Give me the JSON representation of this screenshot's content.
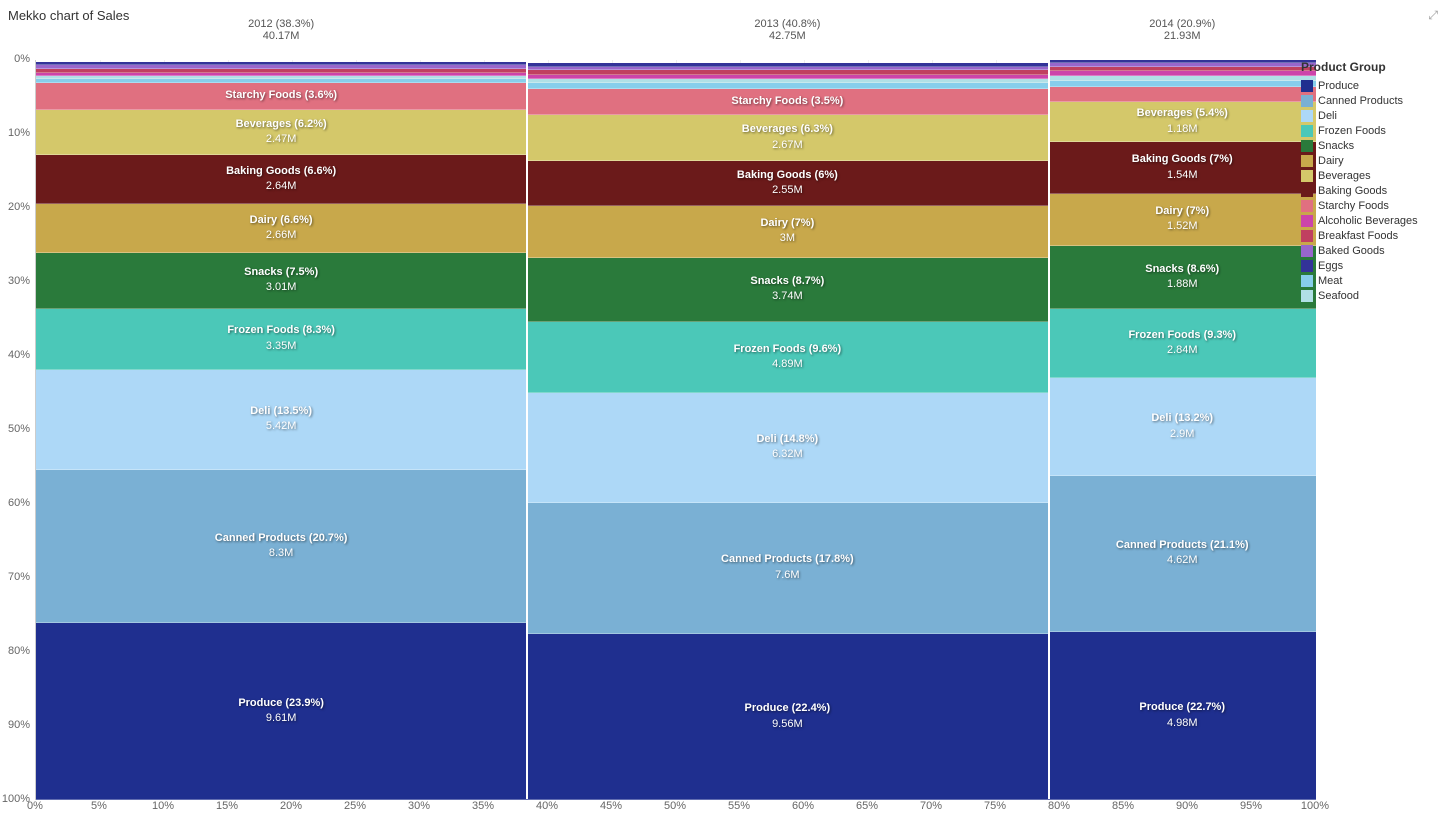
{
  "title": "Mekko chart of Sales",
  "chart": {
    "years": [
      {
        "label": "2012 (38.3%)",
        "sublabel": "40.17M",
        "xStart": 0,
        "width": 38.3
      },
      {
        "label": "2013 (40.8%)",
        "sublabel": "42.75M",
        "xStart": 38.3,
        "width": 40.8
      },
      {
        "label": "2014 (20.9%)",
        "sublabel": "21.93M",
        "xStart": 79.1,
        "width": 20.9
      }
    ],
    "yLabels": [
      "0%",
      "10%",
      "20%",
      "30%",
      "40%",
      "50%",
      "60%",
      "70%",
      "80%",
      "90%",
      "100%"
    ],
    "xLabels": [
      "0%",
      "5%",
      "10%",
      "15%",
      "20%",
      "25%",
      "30%",
      "35%",
      "40%",
      "45%",
      "50%",
      "55%",
      "60%",
      "65%",
      "70%",
      "75%",
      "80%",
      "85%",
      "90%",
      "95%",
      "100%"
    ],
    "segments": {
      "2012": [
        {
          "name": "Produce",
          "pct": 23.9,
          "value": "9.61M",
          "color": "#1f2f8f",
          "yStart": 0,
          "height": 23.9
        },
        {
          "name": "Canned Products",
          "pct": 20.7,
          "value": "8.3M",
          "color": "#7ab0d4",
          "yStart": 23.9,
          "height": 20.7
        },
        {
          "name": "Deli",
          "pct": 13.5,
          "value": "5.42M",
          "color": "#add8f7",
          "yStart": 44.6,
          "height": 13.5
        },
        {
          "name": "Frozen Foods",
          "pct": 8.3,
          "value": "3.35M",
          "color": "#4bc8b8",
          "yStart": 58.1,
          "height": 8.3
        },
        {
          "name": "Snacks",
          "pct": 7.5,
          "value": "3.01M",
          "color": "#2a7a3b",
          "yStart": 66.4,
          "height": 7.5
        },
        {
          "name": "Dairy",
          "pct": 6.6,
          "value": "2.66M",
          "color": "#c8a84b",
          "yStart": 73.9,
          "height": 6.6
        },
        {
          "name": "Baking Goods",
          "pct": 6.6,
          "value": "2.64M",
          "color": "#6b1a1a",
          "yStart": 80.5,
          "height": 6.6
        },
        {
          "name": "Beverages",
          "pct": 6.2,
          "value": "2.47M",
          "color": "#d4c86a",
          "yStart": 87.1,
          "height": 6.2
        },
        {
          "name": "Starchy Foods",
          "pct": 3.6,
          "value": "",
          "color": "#e07080",
          "yStart": 93.3,
          "height": 3.6
        },
        {
          "name": "Meat",
          "pct": 0.5,
          "value": "",
          "color": "#87CEEB",
          "yStart": 96.9,
          "height": 0.5
        },
        {
          "name": "Seafood",
          "pct": 0.4,
          "value": "",
          "color": "#b0e0e6",
          "yStart": 97.4,
          "height": 0.4
        },
        {
          "name": "Alcoholic Beverages",
          "pct": 0.5,
          "value": "",
          "color": "#cc44aa",
          "yStart": 97.8,
          "height": 0.5
        },
        {
          "name": "Breakfast Foods",
          "pct": 0.5,
          "value": "",
          "color": "#c04060",
          "yStart": 98.3,
          "height": 0.5
        },
        {
          "name": "Baked Goods",
          "pct": 0.5,
          "value": "",
          "color": "#9966cc",
          "yStart": 98.8,
          "height": 0.5
        },
        {
          "name": "Eggs",
          "pct": 0.4,
          "value": "",
          "color": "#333399",
          "yStart": 99.3,
          "height": 0.4
        }
      ],
      "2013": [
        {
          "name": "Produce",
          "pct": 22.4,
          "value": "9.56M",
          "color": "#1f2f8f",
          "yStart": 0,
          "height": 22.4
        },
        {
          "name": "Canned Products",
          "pct": 17.8,
          "value": "7.6M",
          "color": "#7ab0d4",
          "yStart": 22.4,
          "height": 17.8
        },
        {
          "name": "Deli",
          "pct": 14.8,
          "value": "6.32M",
          "color": "#add8f7",
          "yStart": 40.2,
          "height": 14.8
        },
        {
          "name": "Frozen Foods",
          "pct": 9.6,
          "value": "4.89M",
          "color": "#4bc8b8",
          "yStart": 55.0,
          "height": 9.6
        },
        {
          "name": "Snacks",
          "pct": 8.7,
          "value": "3.74M",
          "color": "#2a7a3b",
          "yStart": 64.6,
          "height": 8.7
        },
        {
          "name": "Dairy",
          "pct": 7.0,
          "value": "3M",
          "color": "#c8a84b",
          "yStart": 73.3,
          "height": 7.0
        },
        {
          "name": "Baking Goods",
          "pct": 6.0,
          "value": "2.55M",
          "color": "#6b1a1a",
          "yStart": 80.3,
          "height": 6.0
        },
        {
          "name": "Beverages",
          "pct": 6.3,
          "value": "2.67M",
          "color": "#d4c86a",
          "yStart": 86.3,
          "height": 6.3
        },
        {
          "name": "Starchy Foods",
          "pct": 3.5,
          "value": "",
          "color": "#e07080",
          "yStart": 92.6,
          "height": 3.5
        },
        {
          "name": "Meat",
          "pct": 0.8,
          "value": "",
          "color": "#87CEEB",
          "yStart": 96.1,
          "height": 0.8
        },
        {
          "name": "Seafood",
          "pct": 0.5,
          "value": "",
          "color": "#b0e0e6",
          "yStart": 96.9,
          "height": 0.5
        },
        {
          "name": "Alcoholic Beverages",
          "pct": 0.6,
          "value": "",
          "color": "#cc44aa",
          "yStart": 97.4,
          "height": 0.6
        },
        {
          "name": "Breakfast Foods",
          "pct": 0.6,
          "value": "",
          "color": "#c04060",
          "yStart": 98.0,
          "height": 0.6
        },
        {
          "name": "Baked Goods",
          "pct": 0.6,
          "value": "",
          "color": "#9966cc",
          "yStart": 98.6,
          "height": 0.6
        },
        {
          "name": "Eggs",
          "pct": 0.5,
          "value": "",
          "color": "#333399",
          "yStart": 99.1,
          "height": 0.5
        }
      ],
      "2014": [
        {
          "name": "Produce",
          "pct": 22.7,
          "value": "4.98M",
          "color": "#1f2f8f",
          "yStart": 0,
          "height": 22.7
        },
        {
          "name": "Canned Products",
          "pct": 21.1,
          "value": "4.62M",
          "color": "#7ab0d4",
          "yStart": 22.7,
          "height": 21.1
        },
        {
          "name": "Deli",
          "pct": 13.2,
          "value": "2.9M",
          "color": "#add8f7",
          "yStart": 43.8,
          "height": 13.2
        },
        {
          "name": "Frozen Foods",
          "pct": 9.3,
          "value": "2.84M",
          "color": "#4bc8b8",
          "yStart": 57.0,
          "height": 9.3
        },
        {
          "name": "Snacks",
          "pct": 8.6,
          "value": "1.88M",
          "color": "#2a7a3b",
          "yStart": 66.3,
          "height": 8.6
        },
        {
          "name": "Dairy",
          "pct": 7.0,
          "value": "1.52M",
          "color": "#c8a84b",
          "yStart": 74.9,
          "height": 7.0
        },
        {
          "name": "Baking Goods",
          "pct": 7.0,
          "value": "1.54M",
          "color": "#6b1a1a",
          "yStart": 81.9,
          "height": 7.0
        },
        {
          "name": "Beverages",
          "pct": 5.4,
          "value": "1.18M",
          "color": "#d4c86a",
          "yStart": 88.9,
          "height": 5.4
        },
        {
          "name": "Starchy Foods",
          "pct": 2.0,
          "value": "",
          "color": "#e07080",
          "yStart": 94.3,
          "height": 2.0
        },
        {
          "name": "Meat",
          "pct": 0.8,
          "value": "",
          "color": "#87CEEB",
          "yStart": 96.3,
          "height": 0.8
        },
        {
          "name": "Seafood",
          "pct": 0.7,
          "value": "",
          "color": "#b0e0e6",
          "yStart": 97.1,
          "height": 0.7
        },
        {
          "name": "Alcoholic Beverages",
          "pct": 0.7,
          "value": "",
          "color": "#cc44aa",
          "yStart": 97.8,
          "height": 0.7
        },
        {
          "name": "Breakfast Foods",
          "pct": 0.6,
          "value": "",
          "color": "#c04060",
          "yStart": 98.5,
          "height": 0.6
        },
        {
          "name": "Baked Goods",
          "pct": 0.5,
          "value": "",
          "color": "#9966cc",
          "yStart": 99.1,
          "height": 0.5
        },
        {
          "name": "Eggs",
          "pct": 0.4,
          "value": "",
          "color": "#333399",
          "yStart": 99.6,
          "height": 0.4
        }
      ]
    }
  },
  "legend": {
    "title": "Product Group",
    "items": [
      {
        "name": "Produce",
        "color": "#1f2f8f"
      },
      {
        "name": "Canned Products",
        "color": "#7ab0d4"
      },
      {
        "name": "Deli",
        "color": "#add8f7"
      },
      {
        "name": "Frozen Foods",
        "color": "#4bc8b8"
      },
      {
        "name": "Snacks",
        "color": "#2a7a3b"
      },
      {
        "name": "Dairy",
        "color": "#c8a84b"
      },
      {
        "name": "Beverages",
        "color": "#d4c86a"
      },
      {
        "name": "Baking Goods",
        "color": "#6b1a1a"
      },
      {
        "name": "Starchy Foods",
        "color": "#e07080"
      },
      {
        "name": "Alcoholic Beverages",
        "color": "#cc44aa"
      },
      {
        "name": "Breakfast Foods",
        "color": "#c04060"
      },
      {
        "name": "Baked Goods",
        "color": "#9966cc"
      },
      {
        "name": "Eggs",
        "color": "#333399"
      },
      {
        "name": "Meat",
        "color": "#87CEEB"
      },
      {
        "name": "Seafood",
        "color": "#b0e0e6"
      }
    ]
  }
}
